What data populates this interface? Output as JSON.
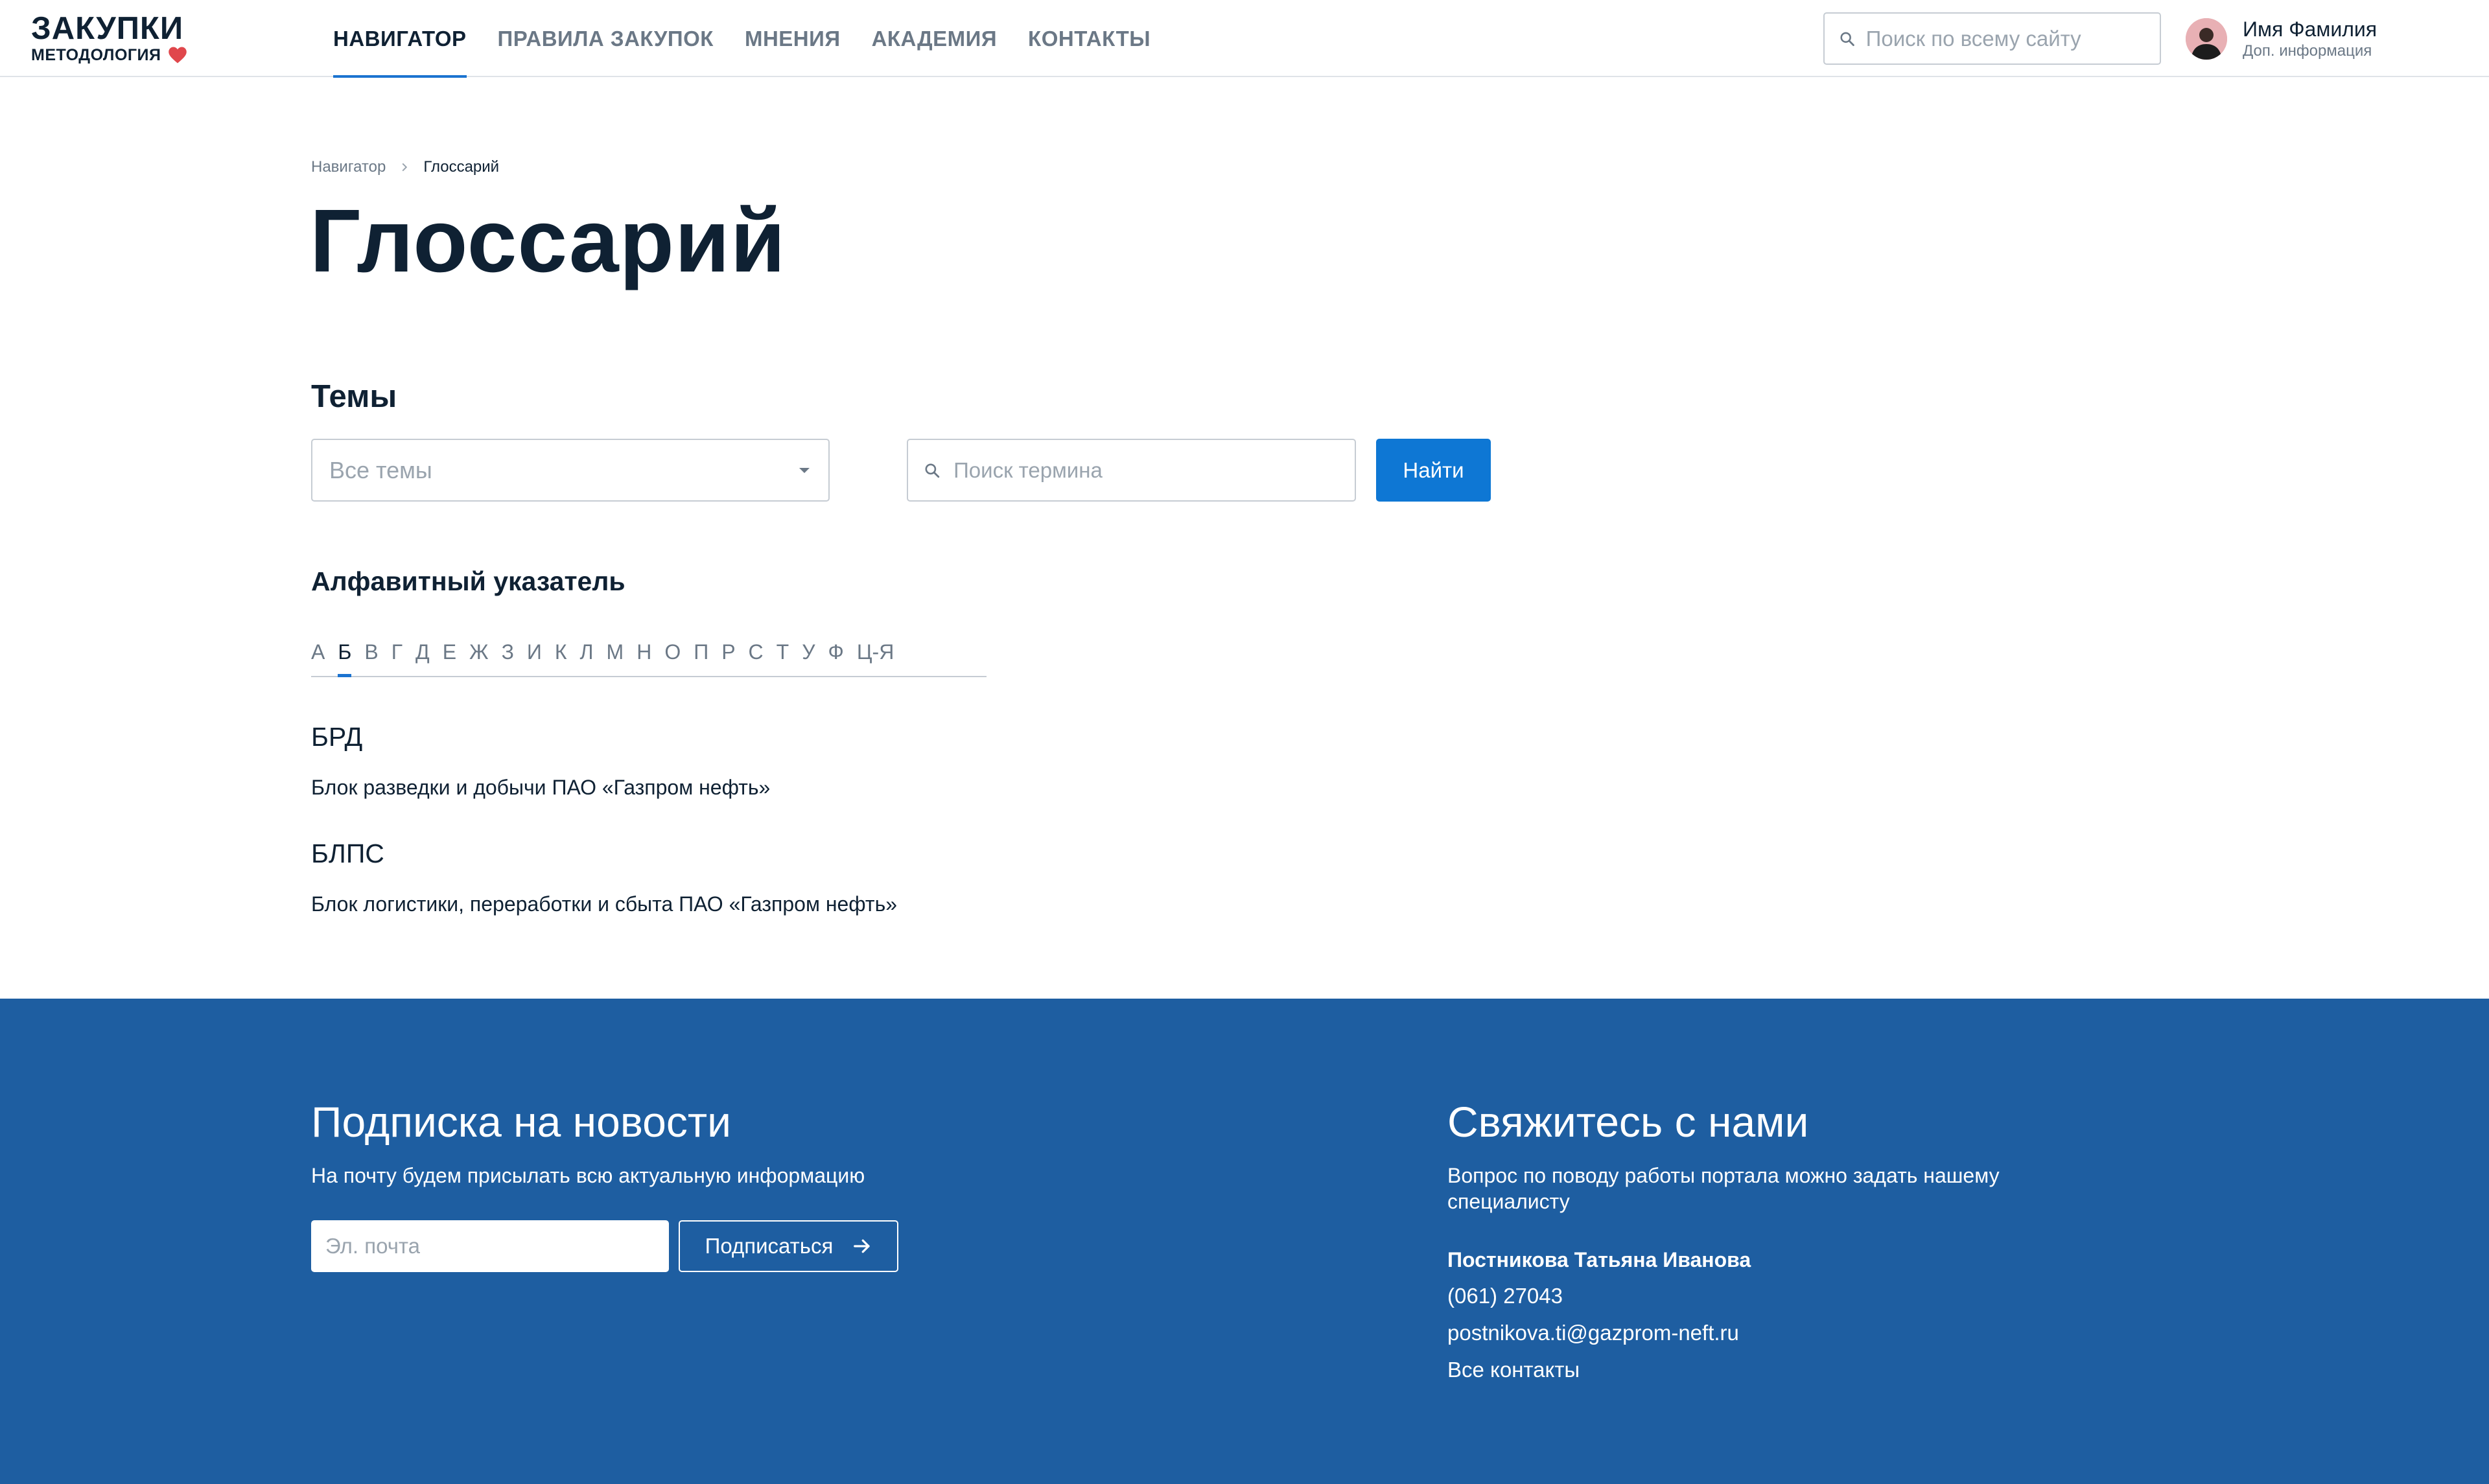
{
  "header": {
    "logo_title": "ЗАКУПКИ",
    "logo_subtitle": "МЕТОДОЛОГИЯ",
    "nav": [
      {
        "label": "НАВИГАТОР",
        "active": true
      },
      {
        "label": "ПРАВИЛА ЗАКУПОК",
        "active": false
      },
      {
        "label": "МНЕНИЯ",
        "active": false
      },
      {
        "label": "АКАДЕМИЯ",
        "active": false
      },
      {
        "label": "КОНТАКТЫ",
        "active": false
      }
    ],
    "search_placeholder": "Поиск по всему сайту",
    "user_name": "Имя Фамилия",
    "user_info": "Доп. информация"
  },
  "breadcrumb": {
    "parent": "Навигатор",
    "current": "Глоссарий"
  },
  "page_title": "Глоссарий",
  "filters": {
    "section_title": "Темы",
    "topic_select_value": "Все темы",
    "term_search_placeholder": "Поиск термина",
    "find_button": "Найти"
  },
  "alphabet": {
    "title": "Алфавитный указатель",
    "letters": [
      "А",
      "Б",
      "В",
      "Г",
      "Д",
      "Е",
      "Ж",
      "З",
      "И",
      "К",
      "Л",
      "М",
      "Н",
      "О",
      "П",
      "Р",
      "С",
      "Т",
      "У",
      "Ф",
      "Ц-Я"
    ],
    "active_letter": "Б"
  },
  "terms": [
    {
      "name": "БРД",
      "definition": "Блок разведки и добычи ПАО «Газпром нефть»"
    },
    {
      "name": "БЛПС",
      "definition": "Блок логистики, переработки и сбыта ПАО «Газпром нефть»"
    }
  ],
  "footer": {
    "subscribe": {
      "title": "Подписка на новости",
      "text": "На почту будем присылать всю актуальную информацию",
      "email_placeholder": "Эл. почта",
      "button": "Подписаться"
    },
    "contact": {
      "title": "Свяжитесь с нами",
      "text_line1": "Вопрос по поводу работы портала можно задать нашему",
      "text_line2": "специалисту",
      "person": "Постникова Татьяна Иванова",
      "phone": "(061) 27043",
      "email": "postnikova.ti@gazprom-neft.ru",
      "all_contacts": "Все контакты"
    }
  },
  "colors": {
    "accent": "#0e77d4",
    "footer_bg": "#1e5ea1",
    "heart": "#e0474c"
  }
}
